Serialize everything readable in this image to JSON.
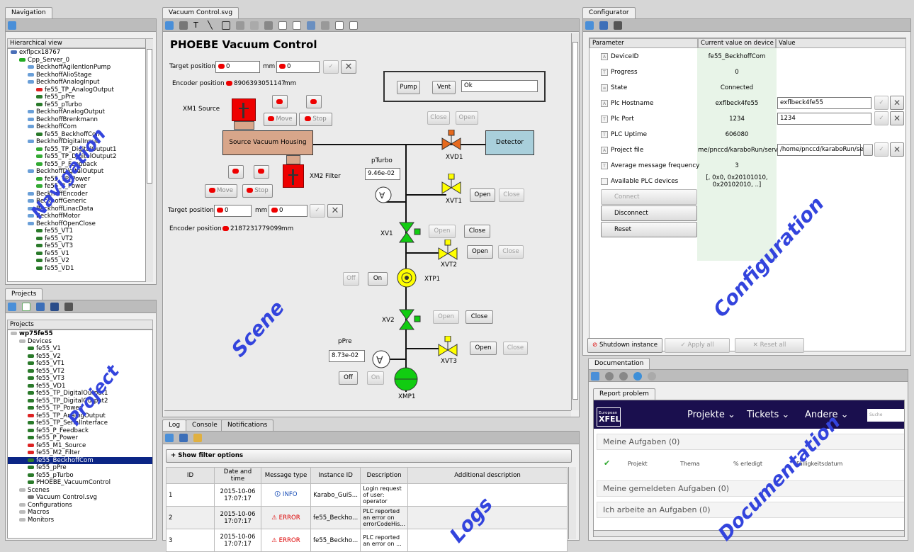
{
  "navigation": {
    "tab": "Navigation",
    "header": "Hierarchical view",
    "items": [
      {
        "label": "exflpcx18767",
        "level": 0,
        "kind": "host"
      },
      {
        "label": "Cpp_Server_0",
        "level": 1,
        "kind": "ok"
      },
      {
        "label": "BeckhoffAgilentIonPump",
        "level": 2,
        "kind": "class"
      },
      {
        "label": "BeckhoffAlioStage",
        "level": 2,
        "kind": "class"
      },
      {
        "label": "BeckhoffAnalogInput",
        "level": 2,
        "kind": "class"
      },
      {
        "label": "fe55_TP_AnalogOutput",
        "level": 3,
        "kind": "err"
      },
      {
        "label": "fe55_pPre",
        "level": 3,
        "kind": "dev"
      },
      {
        "label": "fe55_pTurbo",
        "level": 3,
        "kind": "dev"
      },
      {
        "label": "BeckhoffAnalogOutput",
        "level": 2,
        "kind": "class"
      },
      {
        "label": "BeckhoffBrenkmann",
        "level": 2,
        "kind": "class"
      },
      {
        "label": "BeckhoffCom",
        "level": 2,
        "kind": "class"
      },
      {
        "label": "fe55_BeckhoffCom",
        "level": 3,
        "kind": "dev"
      },
      {
        "label": "BeckhoffDigitalInput",
        "level": 2,
        "kind": "class"
      },
      {
        "label": "fe55_TP_DigitalOutput1",
        "level": 3,
        "kind": "ok2"
      },
      {
        "label": "fe55_TP_DigitalOutput2",
        "level": 3,
        "kind": "ok2"
      },
      {
        "label": "fe55_P_Feedback",
        "level": 3,
        "kind": "ok2"
      },
      {
        "label": "BeckhoffDigitalOutput",
        "level": 2,
        "kind": "class"
      },
      {
        "label": "fe55_TP_Power",
        "level": 3,
        "kind": "ok2"
      },
      {
        "label": "fe55_P_Power",
        "level": 3,
        "kind": "ok2"
      },
      {
        "label": "BeckhoffEncoder",
        "level": 2,
        "kind": "class"
      },
      {
        "label": "BeckhoffGeneric",
        "level": 2,
        "kind": "class"
      },
      {
        "label": "BeckhoffLinacData",
        "level": 2,
        "kind": "class"
      },
      {
        "label": "BeckhoffMotor",
        "level": 2,
        "kind": "class"
      },
      {
        "label": "BeckhoffOpenClose",
        "level": 2,
        "kind": "class"
      },
      {
        "label": "fe55_VT1",
        "level": 3,
        "kind": "dev"
      },
      {
        "label": "fe55_VT2",
        "level": 3,
        "kind": "dev"
      },
      {
        "label": "fe55_VT3",
        "level": 3,
        "kind": "dev"
      },
      {
        "label": "fe55_V1",
        "level": 3,
        "kind": "dev"
      },
      {
        "label": "fe55_V2",
        "level": 3,
        "kind": "dev"
      },
      {
        "label": "fe55_VD1",
        "level": 3,
        "kind": "dev"
      }
    ]
  },
  "projects": {
    "tab": "Projects",
    "header": "Projects",
    "items": [
      {
        "label": "wp75fe55",
        "level": 0,
        "kind": "folder",
        "bold": true
      },
      {
        "label": "Devices",
        "level": 1,
        "kind": "folder"
      },
      {
        "label": "fe55_V1",
        "level": 2,
        "kind": "dev"
      },
      {
        "label": "fe55_V2",
        "level": 2,
        "kind": "dev"
      },
      {
        "label": "fe55_VT1",
        "level": 2,
        "kind": "dev"
      },
      {
        "label": "fe55_VT2",
        "level": 2,
        "kind": "dev"
      },
      {
        "label": "fe55_VT3",
        "level": 2,
        "kind": "dev"
      },
      {
        "label": "fe55_VD1",
        "level": 2,
        "kind": "dev"
      },
      {
        "label": "fe55_TP_DigitalOutput1",
        "level": 2,
        "kind": "dev"
      },
      {
        "label": "fe55_TP_DigitalOutput2",
        "level": 2,
        "kind": "dev"
      },
      {
        "label": "fe55_TP_Power",
        "level": 2,
        "kind": "dev"
      },
      {
        "label": "fe55_TP_AnalogOutput",
        "level": 2,
        "kind": "err"
      },
      {
        "label": "fe55_TP_SerialInterface",
        "level": 2,
        "kind": "dev"
      },
      {
        "label": "fe55_P_Feedback",
        "level": 2,
        "kind": "dev"
      },
      {
        "label": "fe55_P_Power",
        "level": 2,
        "kind": "dev"
      },
      {
        "label": "fe55_M1_Source",
        "level": 2,
        "kind": "err"
      },
      {
        "label": "fe55_M2_Filter",
        "level": 2,
        "kind": "err"
      },
      {
        "label": "fe55_BeckhoffCom",
        "level": 2,
        "kind": "dev",
        "selected": true
      },
      {
        "label": "fe55_pPre",
        "level": 2,
        "kind": "dev"
      },
      {
        "label": "fe55_pTurbo",
        "level": 2,
        "kind": "dev"
      },
      {
        "label": "PHOEBE_VacuumControl",
        "level": 2,
        "kind": "dev"
      },
      {
        "label": "Scenes",
        "level": 1,
        "kind": "folder"
      },
      {
        "label": "Vacuum Control.svg",
        "level": 2,
        "kind": "scene"
      },
      {
        "label": "Configurations",
        "level": 1,
        "kind": "folder"
      },
      {
        "label": "Macros",
        "level": 1,
        "kind": "folder"
      },
      {
        "label": "Monitors",
        "level": 1,
        "kind": "folder"
      }
    ]
  },
  "scene": {
    "tab": "Vacuum Control.svg",
    "title": "PHOEBE Vacuum Control",
    "target_position": "Target position",
    "encoder_position": "Encoder position",
    "unit": "mm",
    "xm1": {
      "target": "0",
      "target2": "0",
      "encoder": "8906393051147",
      "label": "XM1 Source",
      "on": "On",
      "off": "Off",
      "move": "Move",
      "stop": "Stop"
    },
    "xm2": {
      "target": "0",
      "target2": "0",
      "encoder": "2187231779099",
      "label": "XM2 Filter",
      "on": "On",
      "off": "Off",
      "move": "Move",
      "stop": "Stop"
    },
    "pump": "Pump",
    "vent": "Vent",
    "status": "Ok",
    "close": "Close",
    "open": "Open",
    "housing": "Source Vacuum Housing",
    "detector": "Detector",
    "xvd1": "XVD1",
    "xvt1": "XVT1",
    "xvt2": "XVT2",
    "xvt3": "XVT3",
    "xv1": "XV1",
    "xv2": "XV2",
    "xtp1": "XTP1",
    "xmp1": "XMP1",
    "pturbo_label": "pTurbo",
    "pturbo_value": "9.46e-02",
    "ppre_label": "pPre",
    "ppre_value": "8.73e-02",
    "off": "Off",
    "on": "On"
  },
  "logs": {
    "tabs": [
      "Log",
      "Console",
      "Notifications"
    ],
    "filter": "+ Show filter options",
    "columns": [
      "ID",
      "Date and time",
      "Message type",
      "Instance ID",
      "Description",
      "Additional description"
    ],
    "rows": [
      {
        "id": "1",
        "date": "2015-10-06 17:07:17",
        "type": "INFO",
        "instance": "Karabo_GuiS...",
        "desc": "Login request of user: operator",
        "extra": ""
      },
      {
        "id": "2",
        "date": "2015-10-06 17:07:17",
        "type": "ERROR",
        "instance": "fe55_Beckho...",
        "desc": "PLC reported an error on errorCodeHis...",
        "extra": ""
      },
      {
        "id": "3",
        "date": "2015-10-06 17:07:17",
        "type": "ERROR",
        "instance": "fe55_Beckho...",
        "desc": "PLC reported an error on ...",
        "extra": ""
      }
    ]
  },
  "configurator": {
    "tab": "Configurator",
    "columns": [
      "Parameter",
      "Current value on device",
      "Value"
    ],
    "rows": [
      {
        "param": "DeviceID",
        "icon": "A",
        "current": "fe55_BeckhoffCom",
        "value": ""
      },
      {
        "param": "Progress",
        "icon": "T",
        "current": "0",
        "value": ""
      },
      {
        "param": "State",
        "icon": "≡",
        "current": "Connected",
        "value": ""
      },
      {
        "param": "Plc Hostname",
        "icon": "A",
        "current": "exflbeck4fe55",
        "value": "exflbeck4fe55",
        "editable": true
      },
      {
        "param": "Plc Port",
        "icon": "T",
        "current": "1234",
        "value": "1234",
        "editable": true
      },
      {
        "param": "PLC Uptime",
        "icon": "T",
        "current": "606080",
        "value": ""
      },
      {
        "param": "Project file",
        "icon": "A",
        "current": "me/pnccd/karaboRun/serv",
        "value": "/home/pnccd/karaboRun/se",
        "editable": true,
        "file": true
      },
      {
        "param": "Average message frequency",
        "icon": "T",
        "current": "3",
        "value": ""
      },
      {
        "param": "Available PLC devices",
        "icon": "",
        "current": "[, 0x0, 0x20101010, 0x20102010, ..]",
        "value": ""
      }
    ],
    "commands": [
      {
        "label": "Connect",
        "disabled": true
      },
      {
        "label": "Disconnect",
        "disabled": false
      },
      {
        "label": "Reset",
        "disabled": false
      }
    ],
    "shutdown": "Shutdown instance",
    "apply": "Apply all",
    "reset": "Reset all"
  },
  "documentation": {
    "tab": "Documentation",
    "subtab": "Report problem",
    "brand_line1": "European",
    "brand_line2": "XFEL",
    "menu": [
      "Projekte",
      "Tickets",
      "Andere"
    ],
    "search_placeholder": "Suche",
    "section1": "Meine Aufgaben (0)",
    "cols": [
      "Projekt",
      "Thema",
      "% erledigt",
      "Fälligkeitsdatum"
    ],
    "section2": "Meine gemeldeten Aufgaben (0)",
    "section3": "Ich arbeite an Aufgaben (0)"
  },
  "overlays": {
    "navigation": "Navigation",
    "project": "Project",
    "scene": "Scene",
    "logs": "Logs",
    "configuration": "Configuration",
    "documentation": "Documentation"
  },
  "colors": {
    "overlay": "#3344dd",
    "selection": "#0b2585",
    "xfel_bg": "#1a0f4e",
    "panel": "#efefef"
  }
}
